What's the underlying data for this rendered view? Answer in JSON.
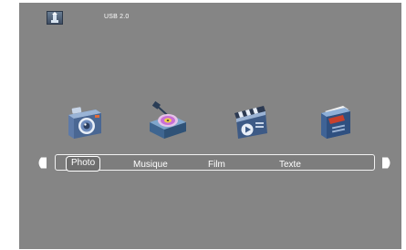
{
  "status": {
    "source": "USB 2.0",
    "source_icon": "usb-drive-icon"
  },
  "menu": {
    "items": [
      {
        "label": "Photo",
        "icon": "camera-icon",
        "selected": true
      },
      {
        "label": "Musique",
        "icon": "music-disc-icon",
        "selected": false
      },
      {
        "label": "Film",
        "icon": "clapperboard-icon",
        "selected": false
      },
      {
        "label": "Texte",
        "icon": "document-icon",
        "selected": false
      }
    ],
    "left_arrow": "arrow-left-icon",
    "right_arrow": "arrow-right-icon"
  },
  "colors": {
    "background": "#858585",
    "bar": "#7d7d7d",
    "text": "#ffffff"
  }
}
